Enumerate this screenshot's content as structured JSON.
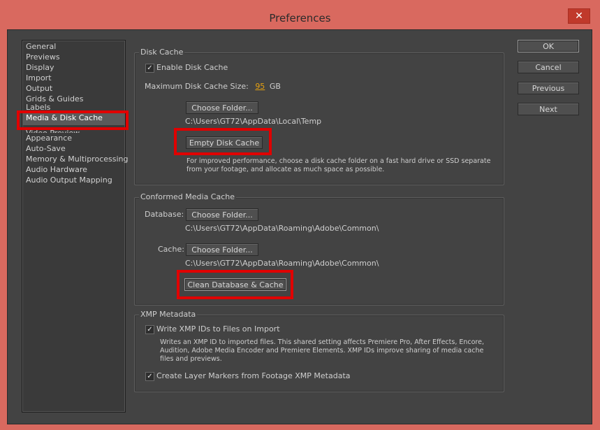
{
  "window": {
    "title": "Preferences",
    "close_glyph": "✕"
  },
  "sidebar": {
    "items": [
      {
        "label": "General"
      },
      {
        "label": "Previews"
      },
      {
        "label": "Display"
      },
      {
        "label": "Import"
      },
      {
        "label": "Output"
      },
      {
        "label": "Grids & Guides"
      },
      {
        "label": "Labels"
      },
      {
        "label": "Media & Disk Cache"
      },
      {
        "label": "Video Preview"
      },
      {
        "label": "Appearance"
      },
      {
        "label": "Auto-Save"
      },
      {
        "label": "Memory & Multiprocessing"
      },
      {
        "label": "Audio Hardware"
      },
      {
        "label": "Audio Output Mapping"
      }
    ],
    "selected_index": 7
  },
  "disk_cache": {
    "title": "Disk Cache",
    "enable_label": "Enable Disk Cache",
    "enable_checked": true,
    "max_size_label": "Maximum Disk Cache Size:",
    "max_size_value": "95",
    "max_size_unit": "GB",
    "choose_folder": "Choose Folder...",
    "folder_path": "C:\\Users\\GT72\\AppData\\Local\\Temp",
    "empty_button": "Empty Disk Cache",
    "note": "For improved performance, choose a disk cache folder on a fast hard drive or SSD separate from your footage, and allocate as much space as possible."
  },
  "conformed": {
    "title": "Conformed Media Cache",
    "database_label": "Database:",
    "database_choose": "Choose Folder...",
    "database_path": "C:\\Users\\GT72\\AppData\\Roaming\\Adobe\\Common\\",
    "cache_label": "Cache:",
    "cache_choose": "Choose Folder...",
    "cache_path": "C:\\Users\\GT72\\AppData\\Roaming\\Adobe\\Common\\",
    "clean_button": "Clean Database & Cache"
  },
  "xmp": {
    "title": "XMP Metadata",
    "write_label": "Write XMP IDs to Files on Import",
    "write_checked": true,
    "write_note": "Writes an XMP ID to imported files. This shared setting affects Premiere Pro, After Effects, Encore, Audition, Adobe Media Encoder and Premiere Elements. XMP IDs improve sharing of media cache files and previews.",
    "markers_label": "Create Layer Markers from Footage XMP Metadata",
    "markers_checked": true
  },
  "buttons": {
    "ok": "OK",
    "cancel": "Cancel",
    "previous": "Previous",
    "next": "Next"
  },
  "colors": {
    "frame": "#d9695f",
    "client": "#434343",
    "highlight": "#e00000",
    "value_accent": "#e5a010"
  }
}
